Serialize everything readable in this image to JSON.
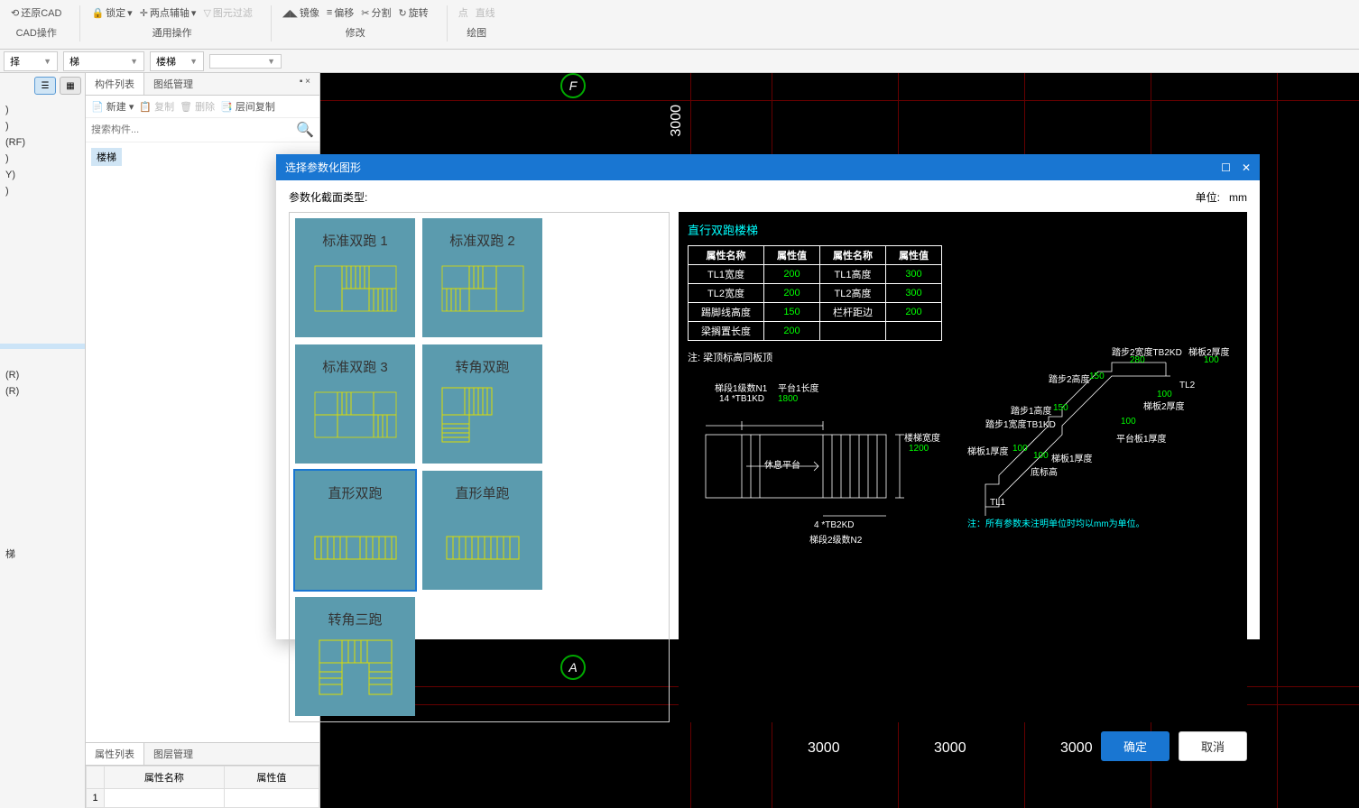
{
  "toolbar": {
    "restore_cad": "还原CAD",
    "cad_ops": "CAD操作",
    "lock": "锁定",
    "two_point_aux": "两点辅轴",
    "filter": "图元过滤",
    "common_ops": "通用操作",
    "mirror": "镜像",
    "offset": "偏移",
    "split": "分割",
    "rotate": "旋转",
    "modify": "修改",
    "point": "点",
    "line": "直线",
    "draw": "绘图"
  },
  "selectors": {
    "s1": "择",
    "s2": "梯",
    "s3": "楼梯"
  },
  "leftPanel": {
    "rf_item": "(RF)",
    "y_item": "Y)",
    "r_item1": "(R)",
    "r_item2": "(R)",
    "stair_item": "梯"
  },
  "midPanel": {
    "tab_components": "构件列表",
    "tab_drawings": "图纸管理",
    "new": "新建",
    "copy": "复制",
    "delete": "删除",
    "layer_copy": "层间复制",
    "search_placeholder": "搜索构件...",
    "tree_item": "楼梯",
    "tab_props": "属性列表",
    "tab_layers": "图层管理",
    "col_name": "属性名称",
    "col_value": "属性值",
    "row_num": "1"
  },
  "canvas": {
    "marker_f": "F",
    "marker_a": "A",
    "dim_3000": "3000"
  },
  "modal": {
    "title": "选择参数化图形",
    "section_label": "参数化截面类型:",
    "unit_label": "单位:",
    "unit_value": "mm",
    "shapes": [
      "标准双跑 1",
      "标准双跑 2",
      "标准双跑 3",
      "转角双跑",
      "直形双跑",
      "直形单跑",
      "转角三跑"
    ],
    "preview_title": "直行双跑楼梯",
    "param_headers": [
      "属性名称",
      "属性值",
      "属性名称",
      "属性值"
    ],
    "param_rows": [
      [
        "TL1宽度",
        "200",
        "TL1高度",
        "300"
      ],
      [
        "TL2宽度",
        "200",
        "TL2高度",
        "300"
      ],
      [
        "踢脚线高度",
        "150",
        "栏杆距边",
        "200"
      ],
      [
        "梁搁置长度",
        "200",
        "",
        ""
      ]
    ],
    "note1": "注: 梁顶标高同板顶",
    "note2": "注：所有参数未注明单位时均以mm为单位。",
    "diagram": {
      "stair1_count": "梯段1级数N1",
      "platform1_len": "平台1长度",
      "val_14": "14",
      "tb1kd": "*TB1KD",
      "val_1800": "1800",
      "rest_platform": "休息平台",
      "stair_width": "楼梯宽度",
      "val_1200": "1200",
      "val_4": "4",
      "tb2kd": "*TB2KD",
      "stair2_count": "梯段2级数N2",
      "step2_w": "踏步2宽度TB2KD",
      "slab2_thk": "梯板2厚度",
      "step2_h": "踏步2高度",
      "val_280": "280",
      "val_100": "100",
      "val_150": "150",
      "tl2": "TL2",
      "slab2_thk2": "梯板2厚度",
      "platform1_thk": "平台板1厚度",
      "step1_h": "踏步1高度",
      "step1_w": "踏步1宽度TB1KD",
      "slab1_thk": "梯板1厚度",
      "slab1_thk2": "梯板1厚度",
      "bot_elev": "底标高",
      "tl1": "TL1"
    },
    "ok": "确定",
    "cancel": "取消"
  }
}
